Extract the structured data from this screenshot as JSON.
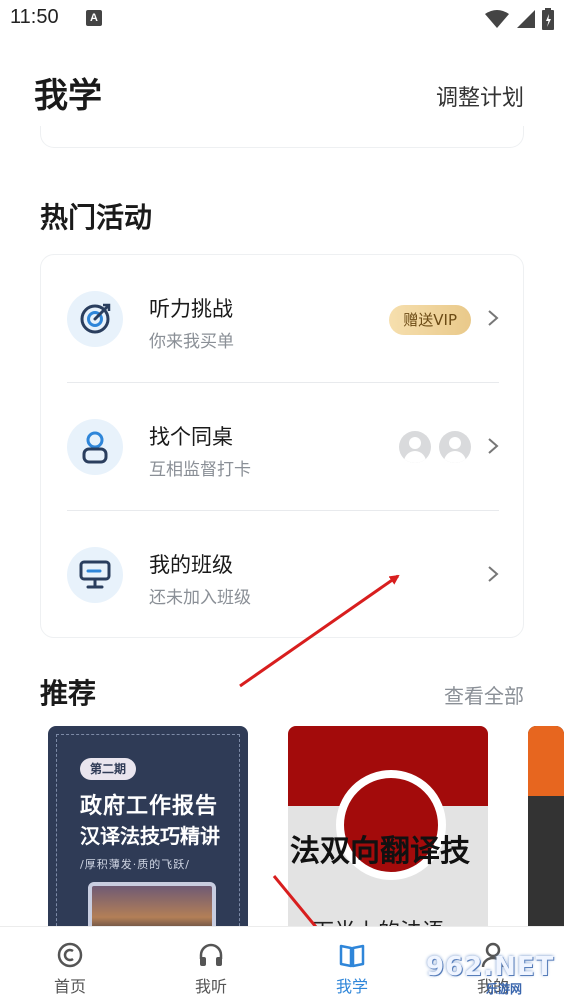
{
  "status_bar": {
    "time": "11:50",
    "a_badge": "A"
  },
  "header": {
    "title": "我学",
    "action": "调整计划"
  },
  "hot": {
    "title": "热门活动",
    "items": [
      {
        "title": "听力挑战",
        "subtitle": "你来我买单",
        "badge": "赠送VIP",
        "icon": "target-icon"
      },
      {
        "title": "找个同桌",
        "subtitle": "互相监督打卡",
        "icon": "person-icon"
      },
      {
        "title": "我的班级",
        "subtitle": "还未加入班级",
        "icon": "classroom-screen-icon"
      }
    ]
  },
  "recommend": {
    "title": "推荐",
    "view_all": "查看全部",
    "cards": [
      {
        "issue": "第二期",
        "title_line1": "政府工作报告",
        "title_line2": "汉译法技巧精讲",
        "subtitle": "/厚积薄发·质的飞跃/"
      },
      {
        "title": "法双向翻译技",
        "subtitle": "下半上的法语"
      },
      {}
    ]
  },
  "tabbar": {
    "tabs": [
      {
        "label": "首页",
        "icon": "home-icon"
      },
      {
        "label": "我听",
        "icon": "headphones-icon"
      },
      {
        "label": "我学",
        "icon": "book-icon",
        "active": true
      },
      {
        "label": "我的",
        "icon": "profile-icon"
      }
    ]
  },
  "watermark": {
    "text": "962.NET",
    "sub": "乐游网"
  },
  "colors": {
    "accent": "#2f86d9",
    "vip": "#e9c98a",
    "annotation_arrow": "#d81e1e"
  }
}
